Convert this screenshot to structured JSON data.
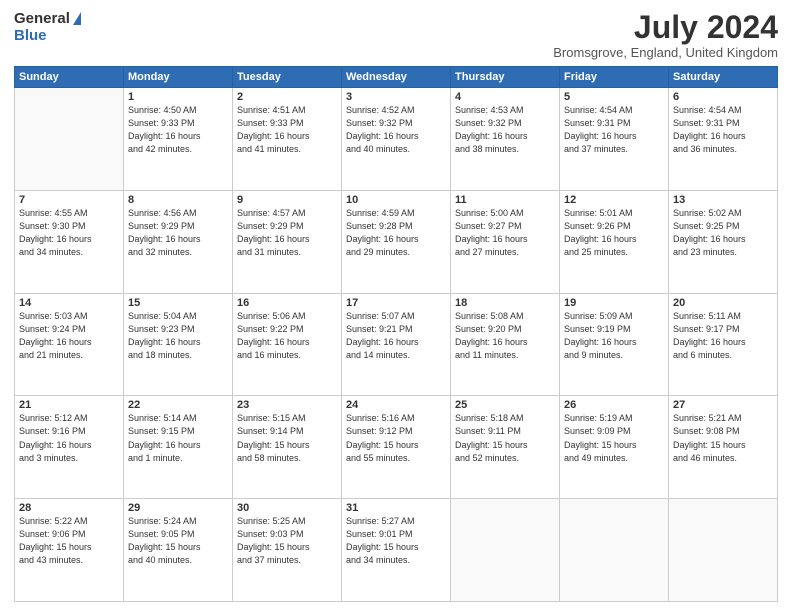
{
  "header": {
    "logo_general": "General",
    "logo_blue": "Blue",
    "month_year": "July 2024",
    "location": "Bromsgrove, England, United Kingdom"
  },
  "days_of_week": [
    "Sunday",
    "Monday",
    "Tuesday",
    "Wednesday",
    "Thursday",
    "Friday",
    "Saturday"
  ],
  "weeks": [
    [
      {
        "day": "",
        "info": ""
      },
      {
        "day": "1",
        "info": "Sunrise: 4:50 AM\nSunset: 9:33 PM\nDaylight: 16 hours\nand 42 minutes."
      },
      {
        "day": "2",
        "info": "Sunrise: 4:51 AM\nSunset: 9:33 PM\nDaylight: 16 hours\nand 41 minutes."
      },
      {
        "day": "3",
        "info": "Sunrise: 4:52 AM\nSunset: 9:32 PM\nDaylight: 16 hours\nand 40 minutes."
      },
      {
        "day": "4",
        "info": "Sunrise: 4:53 AM\nSunset: 9:32 PM\nDaylight: 16 hours\nand 38 minutes."
      },
      {
        "day": "5",
        "info": "Sunrise: 4:54 AM\nSunset: 9:31 PM\nDaylight: 16 hours\nand 37 minutes."
      },
      {
        "day": "6",
        "info": "Sunrise: 4:54 AM\nSunset: 9:31 PM\nDaylight: 16 hours\nand 36 minutes."
      }
    ],
    [
      {
        "day": "7",
        "info": "Sunrise: 4:55 AM\nSunset: 9:30 PM\nDaylight: 16 hours\nand 34 minutes."
      },
      {
        "day": "8",
        "info": "Sunrise: 4:56 AM\nSunset: 9:29 PM\nDaylight: 16 hours\nand 32 minutes."
      },
      {
        "day": "9",
        "info": "Sunrise: 4:57 AM\nSunset: 9:29 PM\nDaylight: 16 hours\nand 31 minutes."
      },
      {
        "day": "10",
        "info": "Sunrise: 4:59 AM\nSunset: 9:28 PM\nDaylight: 16 hours\nand 29 minutes."
      },
      {
        "day": "11",
        "info": "Sunrise: 5:00 AM\nSunset: 9:27 PM\nDaylight: 16 hours\nand 27 minutes."
      },
      {
        "day": "12",
        "info": "Sunrise: 5:01 AM\nSunset: 9:26 PM\nDaylight: 16 hours\nand 25 minutes."
      },
      {
        "day": "13",
        "info": "Sunrise: 5:02 AM\nSunset: 9:25 PM\nDaylight: 16 hours\nand 23 minutes."
      }
    ],
    [
      {
        "day": "14",
        "info": "Sunrise: 5:03 AM\nSunset: 9:24 PM\nDaylight: 16 hours\nand 21 minutes."
      },
      {
        "day": "15",
        "info": "Sunrise: 5:04 AM\nSunset: 9:23 PM\nDaylight: 16 hours\nand 18 minutes."
      },
      {
        "day": "16",
        "info": "Sunrise: 5:06 AM\nSunset: 9:22 PM\nDaylight: 16 hours\nand 16 minutes."
      },
      {
        "day": "17",
        "info": "Sunrise: 5:07 AM\nSunset: 9:21 PM\nDaylight: 16 hours\nand 14 minutes."
      },
      {
        "day": "18",
        "info": "Sunrise: 5:08 AM\nSunset: 9:20 PM\nDaylight: 16 hours\nand 11 minutes."
      },
      {
        "day": "19",
        "info": "Sunrise: 5:09 AM\nSunset: 9:19 PM\nDaylight: 16 hours\nand 9 minutes."
      },
      {
        "day": "20",
        "info": "Sunrise: 5:11 AM\nSunset: 9:17 PM\nDaylight: 16 hours\nand 6 minutes."
      }
    ],
    [
      {
        "day": "21",
        "info": "Sunrise: 5:12 AM\nSunset: 9:16 PM\nDaylight: 16 hours\nand 3 minutes."
      },
      {
        "day": "22",
        "info": "Sunrise: 5:14 AM\nSunset: 9:15 PM\nDaylight: 16 hours\nand 1 minute."
      },
      {
        "day": "23",
        "info": "Sunrise: 5:15 AM\nSunset: 9:14 PM\nDaylight: 15 hours\nand 58 minutes."
      },
      {
        "day": "24",
        "info": "Sunrise: 5:16 AM\nSunset: 9:12 PM\nDaylight: 15 hours\nand 55 minutes."
      },
      {
        "day": "25",
        "info": "Sunrise: 5:18 AM\nSunset: 9:11 PM\nDaylight: 15 hours\nand 52 minutes."
      },
      {
        "day": "26",
        "info": "Sunrise: 5:19 AM\nSunset: 9:09 PM\nDaylight: 15 hours\nand 49 minutes."
      },
      {
        "day": "27",
        "info": "Sunrise: 5:21 AM\nSunset: 9:08 PM\nDaylight: 15 hours\nand 46 minutes."
      }
    ],
    [
      {
        "day": "28",
        "info": "Sunrise: 5:22 AM\nSunset: 9:06 PM\nDaylight: 15 hours\nand 43 minutes."
      },
      {
        "day": "29",
        "info": "Sunrise: 5:24 AM\nSunset: 9:05 PM\nDaylight: 15 hours\nand 40 minutes."
      },
      {
        "day": "30",
        "info": "Sunrise: 5:25 AM\nSunset: 9:03 PM\nDaylight: 15 hours\nand 37 minutes."
      },
      {
        "day": "31",
        "info": "Sunrise: 5:27 AM\nSunset: 9:01 PM\nDaylight: 15 hours\nand 34 minutes."
      },
      {
        "day": "",
        "info": ""
      },
      {
        "day": "",
        "info": ""
      },
      {
        "day": "",
        "info": ""
      }
    ]
  ]
}
